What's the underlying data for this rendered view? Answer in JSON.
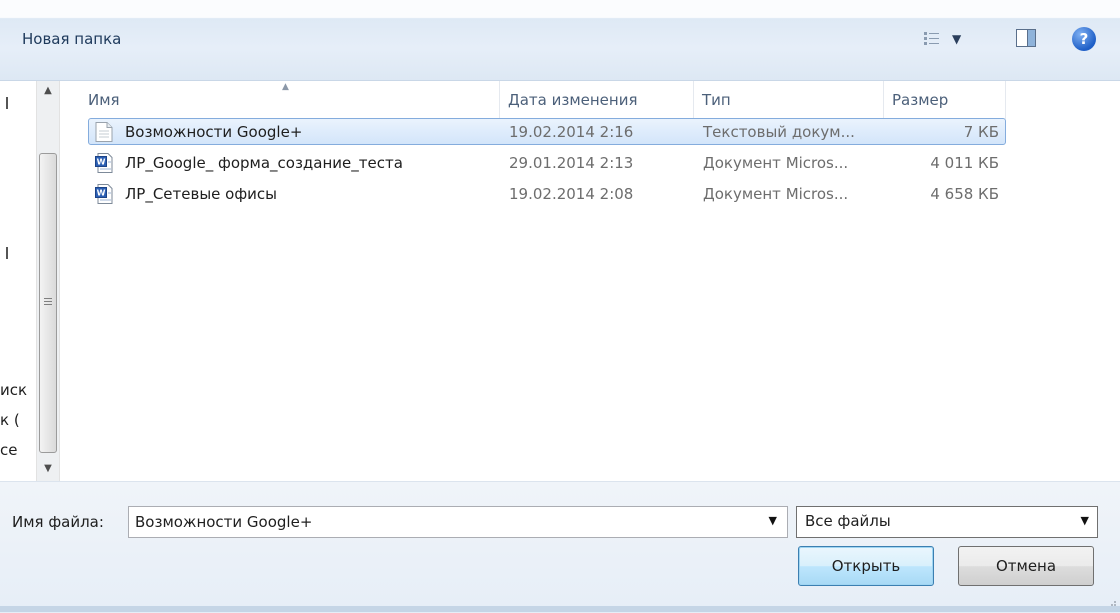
{
  "toolbar": {
    "new_folder_label": "Новая папка",
    "views_icon": "view-details-icon",
    "preview_icon": "preview-pane-icon",
    "help_icon": "help-icon",
    "help_glyph": "?"
  },
  "nav_pane": {
    "fragments": [
      "иск",
      "к (",
      "се"
    ]
  },
  "file_list": {
    "columns": [
      "Имя",
      "Дата изменения",
      "Тип",
      "Размер"
    ],
    "sort_indicator": "▲",
    "rows": [
      {
        "name": "Возможности Google+",
        "date": "19.02.2014 2:16",
        "type": "Текстовый докум...",
        "size": "7 КБ",
        "icon": "text-document-icon",
        "selected": true
      },
      {
        "name": "ЛР_Google_ форма_создание_теста",
        "date": "29.01.2014 2:13",
        "type": "Документ Micros...",
        "size": "4 011 КБ",
        "icon": "word-document-icon",
        "selected": false
      },
      {
        "name": "ЛР_Сетевые офисы",
        "date": "19.02.2014 2:08",
        "type": "Документ Micros...",
        "size": "4 658 КБ",
        "icon": "word-document-icon",
        "selected": false
      }
    ]
  },
  "bottom": {
    "filename_label": "Имя файла:",
    "filename_value": "Возможности Google+",
    "filter_value": "Все файлы",
    "open_label": "Открыть",
    "cancel_label": "Отмена"
  },
  "colors": {
    "toolbar_text": "#1e395b",
    "selection_border": "#84acdd",
    "primary_button_border": "#3c7fb1"
  }
}
